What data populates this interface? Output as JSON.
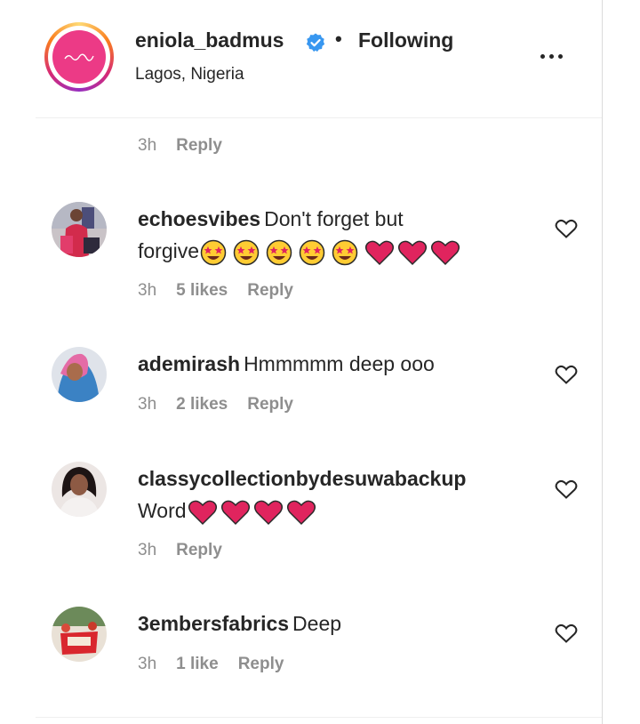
{
  "post_header": {
    "username": "eniola_badmus",
    "separator": "•",
    "follow_status": "Following",
    "location": "Lagos, Nigeria",
    "verified": true
  },
  "previous_comment_meta": {
    "timestamp": "3h",
    "reply_label": "Reply"
  },
  "comments": [
    {
      "username": "echoesvibes",
      "text_line1": "Don't forget but",
      "text_line2": "forgive",
      "emojis": [
        "star-struck",
        "star-struck",
        "star-struck",
        "star-struck",
        "star-struck",
        "red-heart",
        "red-heart",
        "red-heart"
      ],
      "timestamp": "3h",
      "likes": "5 likes",
      "reply_label": "Reply"
    },
    {
      "username": "ademirash",
      "text_line1": "Hmmmmm deep ooo",
      "timestamp": "3h",
      "likes": "2 likes",
      "reply_label": "Reply"
    },
    {
      "username": "classycollectionbydesuwabackup",
      "text_line2": "Word",
      "emojis": [
        "red-heart",
        "red-heart",
        "red-heart",
        "red-heart"
      ],
      "timestamp": "3h",
      "reply_label": "Reply"
    },
    {
      "username": "3embersfabrics",
      "text_line1": "Deep",
      "timestamp": "3h",
      "likes": "1 like",
      "reply_label": "Reply"
    }
  ],
  "colors": {
    "text": "#262626",
    "secondary": "#8e8e8e",
    "verified_blue": "#3897f0",
    "divider": "#efefef",
    "heart_red": "#e0245e",
    "avatar_pink": "#ec3a86"
  }
}
